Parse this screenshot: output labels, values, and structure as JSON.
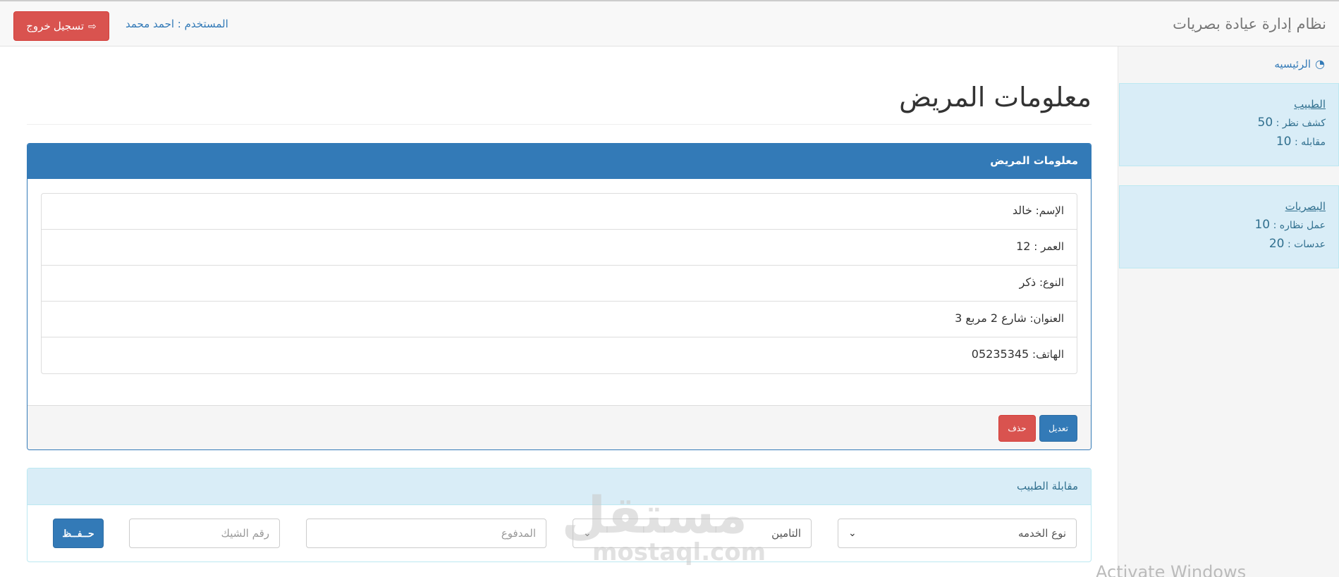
{
  "header": {
    "brand": "نظام إدارة عيادة بصريات",
    "user_label": "المستخدم : احمد محمد",
    "logout_label": "تسجيل خروج"
  },
  "sidebar": {
    "home_label": "الرئيسيه",
    "doctor": {
      "title": "الطبيب",
      "lines": [
        {
          "label": "كشف نظر :",
          "value": "50"
        },
        {
          "label": "مقابله :",
          "value": "10"
        }
      ]
    },
    "optics": {
      "title": "البصريات",
      "lines": [
        {
          "label": "عمل نظاره :",
          "value": "10"
        },
        {
          "label": "عدسات :",
          "value": "20"
        }
      ]
    }
  },
  "page": {
    "title": "معلومات المريض"
  },
  "patient_panel": {
    "heading": "معلومات المريض",
    "fields": [
      {
        "label": "الإسم:",
        "value": "خالد"
      },
      {
        "label": "العمر :",
        "value": "12"
      },
      {
        "label": "النوع:",
        "value": "ذكر"
      },
      {
        "label": "العنوان:",
        "value": "شارع 2 مربع 3"
      },
      {
        "label": "الهاتف:",
        "value": "05235345"
      }
    ],
    "edit_label": "تعديل",
    "delete_label": "حذف"
  },
  "appointment_panel": {
    "heading": "مقابلة الطبيب",
    "service_select": "نوع الخدمه",
    "insurance_select": "التامين",
    "paid_placeholder": "المدفوع",
    "cheque_placeholder": "رقم الشيك",
    "save_label": "حــفــظ"
  },
  "watermark": {
    "arabic": "مستقل",
    "latin": "mostaql.com"
  },
  "os_overlay": "Activate Windows"
}
